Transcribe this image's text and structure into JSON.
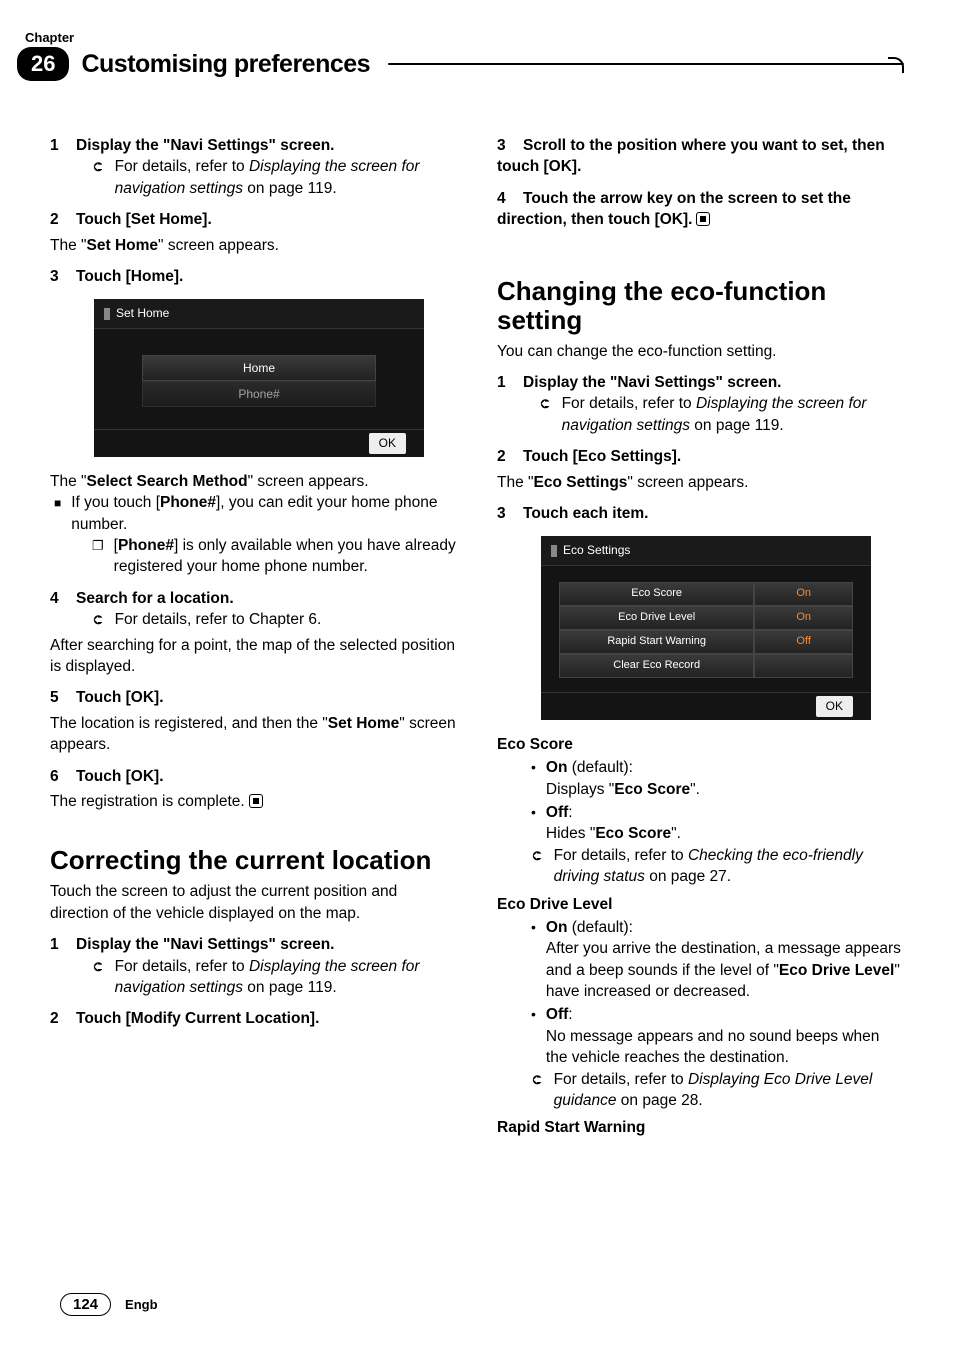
{
  "header": {
    "chapter_label": "Chapter",
    "chapter_number": "26",
    "chapter_title": "Customising preferences"
  },
  "left": {
    "s1": {
      "num": "1",
      "text": "Display the \"Navi Settings\" screen."
    },
    "s1_ref_a": "For details, refer to ",
    "s1_ref_b": "Displaying the screen for navigation settings",
    "s1_ref_c": " on page 119.",
    "s2": {
      "num": "2",
      "text": "Touch [Set Home]."
    },
    "s2_body_a": "The \"",
    "s2_body_b": "Set Home",
    "s2_body_c": "\" screen appears.",
    "s3": {
      "num": "3",
      "text": "Touch [Home]."
    },
    "scr1_title": "Set Home",
    "scr1_home": "Home",
    "scr1_phone": "Phone#",
    "scr1_ok": "OK",
    "afterscr_a": "The \"",
    "afterscr_b": "Select Search Method",
    "afterscr_c": "\" screen appears.",
    "bullet_a": "If you touch [",
    "bullet_b": "Phone#",
    "bullet_c": "], you can edit your home phone number.",
    "note_a": "[",
    "note_b": "Phone#",
    "note_c": "] is only available when you have already registered your home phone number.",
    "s4": {
      "num": "4",
      "text": "Search for a location."
    },
    "s4_ref": "For details, refer to Chapter 6.",
    "s4_body": "After searching for a point, the map of the selected position is displayed.",
    "s5": {
      "num": "5",
      "text": "Touch [OK]."
    },
    "s5_body_a": "The location is registered, and then the \"",
    "s5_body_b": "Set Home",
    "s5_body_c": "\" screen appears.",
    "s6": {
      "num": "6",
      "text": "Touch [OK]."
    },
    "s6_body": "The registration is complete.",
    "sec2_title": "Correcting the current location",
    "sec2_intro": "Touch the screen to adjust the current position and direction of the vehicle displayed on the map.",
    "sec2_s1": {
      "num": "1",
      "text": "Display the \"Navi Settings\" screen."
    },
    "sec2_s1_ref_a": "For details, refer to ",
    "sec2_s1_ref_b": "Displaying the screen for navigation settings",
    "sec2_s1_ref_c": " on page 119.",
    "sec2_s2": {
      "num": "2",
      "text": "Touch [Modify Current Location]."
    }
  },
  "right": {
    "r3": {
      "num": "3",
      "text": "Scroll to the position where you want to set, then touch [OK]."
    },
    "r4": {
      "num": "4",
      "text": "Touch the arrow key on the screen to set the direction, then touch [OK]."
    },
    "sec3_title": "Changing the eco-function setting",
    "sec3_intro": "You can change the eco-function setting.",
    "sec3_s1": {
      "num": "1",
      "text": "Display the \"Navi Settings\" screen."
    },
    "sec3_s1_ref_a": "For details, refer to ",
    "sec3_s1_ref_b": "Displaying the screen for navigation settings",
    "sec3_s1_ref_c": " on page 119.",
    "sec3_s2": {
      "num": "2",
      "text": "Touch [Eco Settings]."
    },
    "sec3_s2_a": "The \"",
    "sec3_s2_b": "Eco Settings",
    "sec3_s2_c": "\" screen appears.",
    "sec3_s3": {
      "num": "3",
      "text": "Touch each item."
    },
    "scr2_title": "Eco Settings",
    "scr2_rows": [
      {
        "label": "Eco Score",
        "value": "On"
      },
      {
        "label": "Eco Drive Level",
        "value": "On"
      },
      {
        "label": "Rapid Start Warning",
        "value": "Off"
      },
      {
        "label": "Clear Eco Record",
        "value": ""
      }
    ],
    "scr2_ok": "OK",
    "eco_score_name": "Eco Score",
    "eco_score_on_a": "On",
    "eco_score_on_b": " (default):",
    "eco_score_on_c": "Displays \"",
    "eco_score_on_d": "Eco Score",
    "eco_score_on_e": "\".",
    "eco_score_off_a": "Off",
    "eco_score_off_b": ":",
    "eco_score_off_c": "Hides \"",
    "eco_score_off_d": "Eco Score",
    "eco_score_off_e": "\".",
    "eco_score_ref_a": "For details, refer to ",
    "eco_score_ref_b": "Checking the eco-friendly driving status",
    "eco_score_ref_c": " on page 27.",
    "eco_drive_name": "Eco Drive Level",
    "eco_drive_on_a": "On",
    "eco_drive_on_b": " (default):",
    "eco_drive_on_c": "After you arrive the destination, a message appears and a beep sounds if the level of \"",
    "eco_drive_on_d": "Eco Drive Level",
    "eco_drive_on_e": "\" have increased or decreased.",
    "eco_drive_off_a": "Off",
    "eco_drive_off_b": ":",
    "eco_drive_off_c": "No message appears and no sound beeps when the vehicle reaches the destination.",
    "eco_drive_ref_a": "For details, refer to ",
    "eco_drive_ref_b": "Displaying Eco Drive Level guidance",
    "eco_drive_ref_c": " on page 28.",
    "rapid_name": "Rapid Start Warning"
  },
  "footer": {
    "page": "124",
    "lang": "Engb"
  }
}
